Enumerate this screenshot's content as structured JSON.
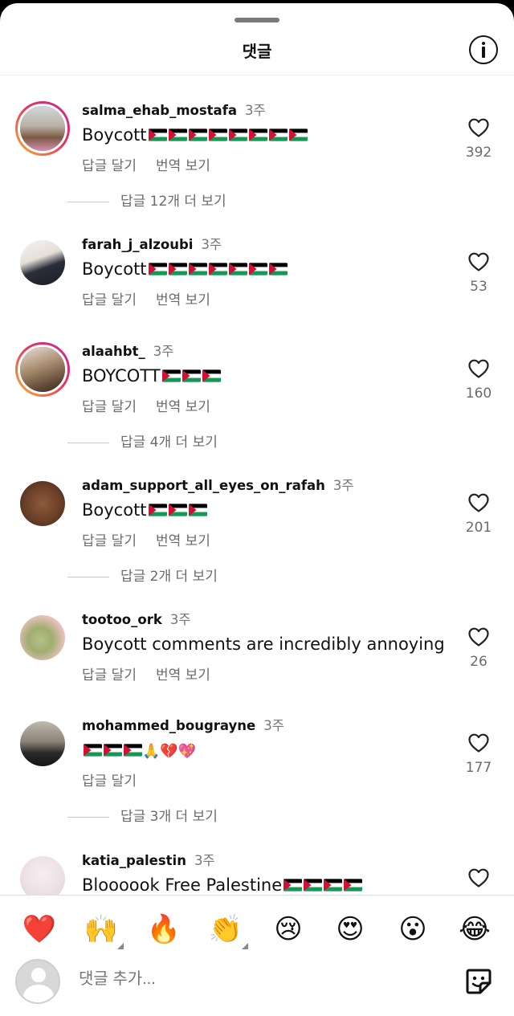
{
  "header": {
    "title": "댓글"
  },
  "comments": [
    {
      "username": "salma_ehab_mostafa",
      "time": "3주",
      "text": "Boycott",
      "flags": 8,
      "extra_emoji": "",
      "reply_label": "답글 달기",
      "translate_label": "번역 보기",
      "likes": "392",
      "view_replies": "답글 12개 더 보기",
      "has_ring": true,
      "avatar": "salma-avatar"
    },
    {
      "username": "farah_j_alzoubi",
      "time": "3주",
      "text": "Boycott",
      "flags": 7,
      "extra_emoji": "",
      "reply_label": "답글 달기",
      "translate_label": "번역 보기",
      "likes": "53",
      "view_replies": "",
      "has_ring": false,
      "avatar": "farah-avatar"
    },
    {
      "username": "alaahbt_",
      "time": "3주",
      "text": "BOYCOTT",
      "flags": 3,
      "extra_emoji": "",
      "reply_label": "답글 달기",
      "translate_label": "번역 보기",
      "likes": "160",
      "view_replies": "답글 4개 더 보기",
      "has_ring": true,
      "avatar": "alaa-avatar"
    },
    {
      "username": "adam_support_all_eyes_on_rafah",
      "time": "3주",
      "text": "Boycott",
      "flags": 3,
      "extra_emoji": "",
      "reply_label": "답글 달기",
      "translate_label": "번역 보기",
      "likes": "201",
      "view_replies": "답글 2개 더 보기",
      "has_ring": false,
      "avatar": "rafah-avatar"
    },
    {
      "username": "tootoo_ork",
      "time": "3주",
      "text": "Boycott comments are incredibly annoying",
      "flags": 0,
      "extra_emoji": "",
      "reply_label": "답글 달기",
      "translate_label": "번역 보기",
      "likes": "26",
      "view_replies": "",
      "has_ring": false,
      "avatar": "tootoo-avatar"
    },
    {
      "username": "mohammed_bougrayne",
      "time": "3주",
      "text": "",
      "flags": 3,
      "extra_emoji": "🙏💔💖",
      "reply_label": "답글 달기",
      "translate_label": "",
      "likes": "177",
      "view_replies": "답글 3개 더 보기",
      "has_ring": false,
      "avatar": "mohammed-avatar"
    },
    {
      "username": "katia_palestin",
      "time": "3주",
      "text": "Bloooook Free Palestine",
      "flags": 4,
      "extra_emoji": "",
      "reply_label": "",
      "translate_label": "",
      "likes": "",
      "view_replies": "",
      "has_ring": false,
      "avatar": "katia-avatar"
    }
  ],
  "emoji_bar": [
    "❤️",
    "🙌",
    "🔥",
    "👏",
    "😢",
    "😍",
    "😮",
    "😂"
  ],
  "input": {
    "placeholder": "댓글 추가..."
  },
  "icons": {
    "info": "info-icon",
    "like": "heart-outline-icon",
    "sticker": "sticker-icon",
    "flag": "palestine-flag-icon"
  },
  "colors": {
    "muted": "#6b6b6b",
    "flag_red": "#d21034",
    "flag_green": "#149954",
    "flag_black": "#000000"
  }
}
